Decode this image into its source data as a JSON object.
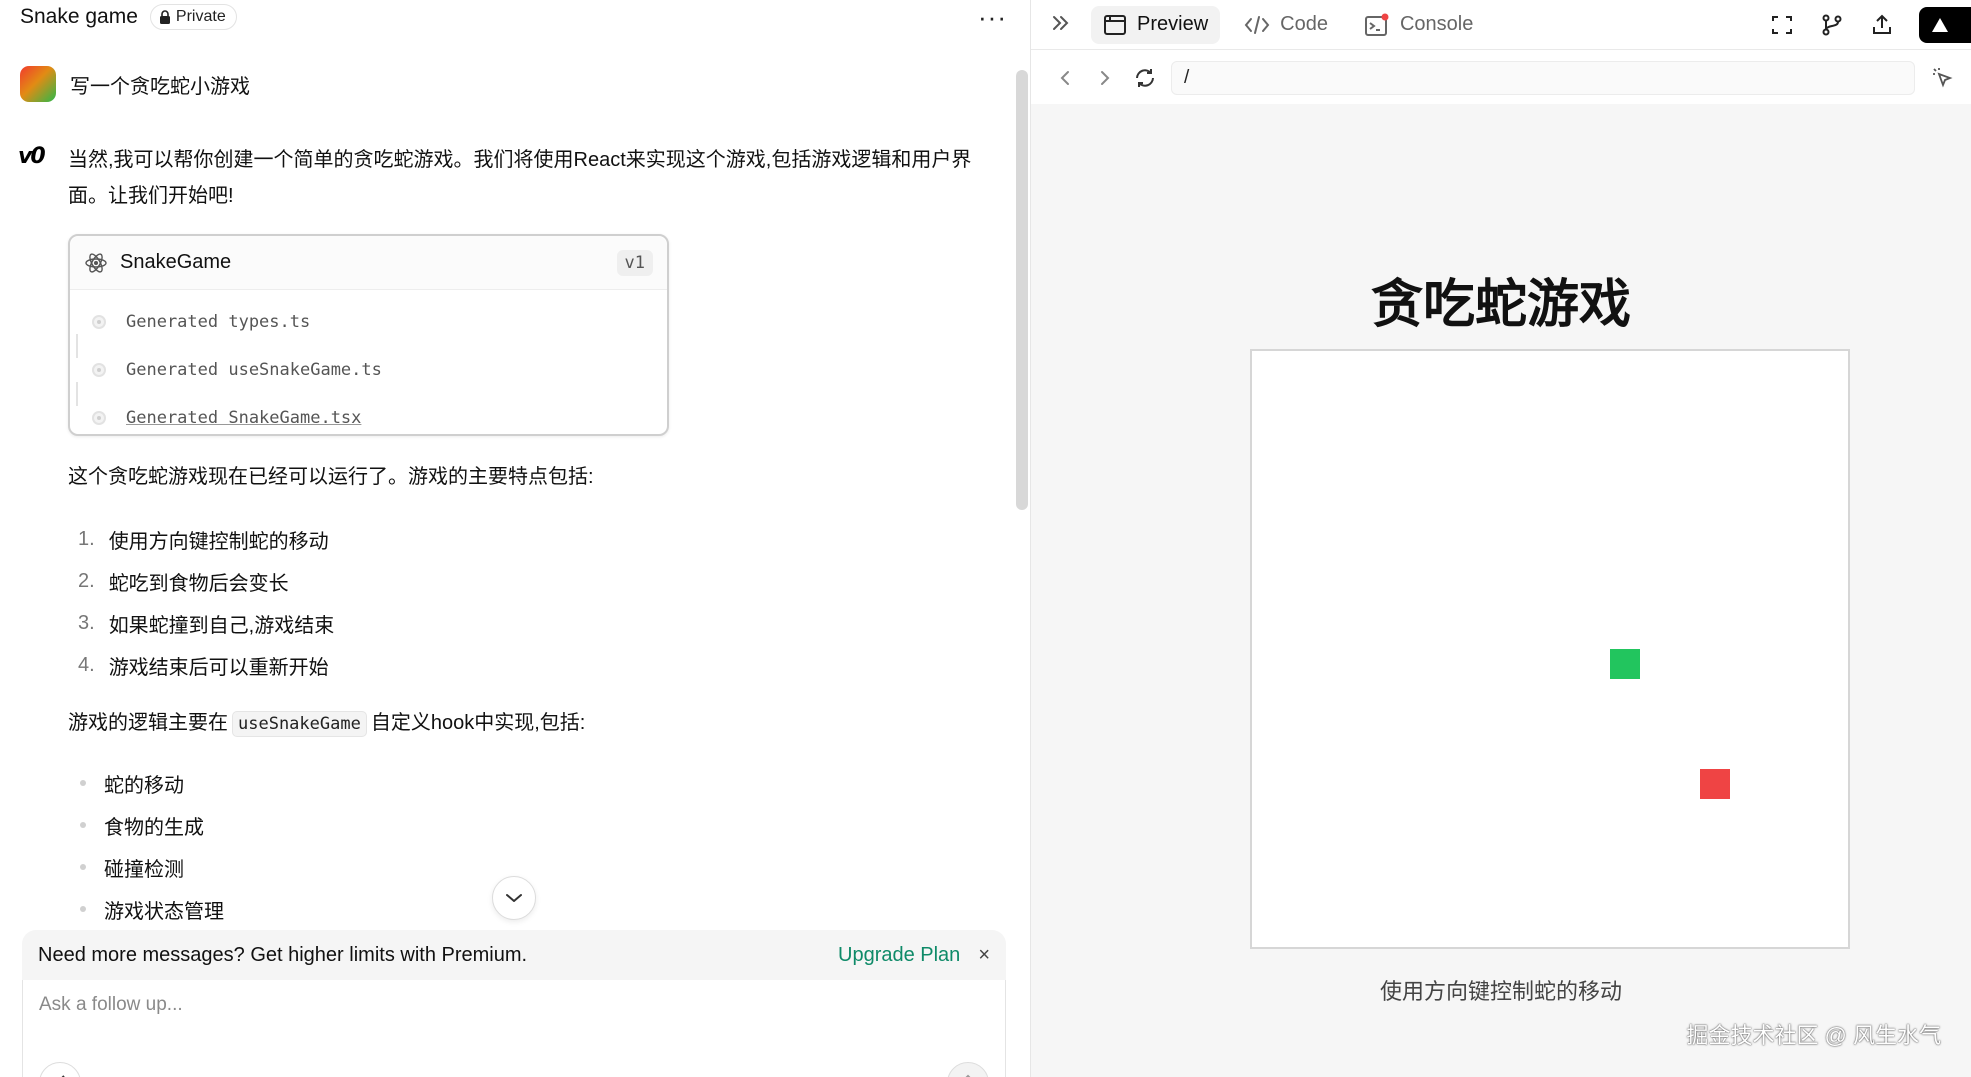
{
  "chat": {
    "title": "Snake game",
    "privacy_label": "Private",
    "more_label": "···"
  },
  "user_message": {
    "text": "写一个贪吃蛇小游戏"
  },
  "assistant": {
    "logo": "v0",
    "intro": "当然,我可以帮你创建一个简单的贪吃蛇游戏。我们将使用React来实现这个游戏,包括游戏逻辑和用户界面。让我们开始吧!",
    "artifact": {
      "name": "SnakeGame",
      "version": "v1",
      "steps": [
        "Generated types.ts",
        "Generated useSnakeGame.ts",
        "Generated SnakeGame.tsx"
      ]
    },
    "features_intro": "这个贪吃蛇游戏现在已经可以运行了。游戏的主要特点包括:",
    "features": [
      {
        "num": "1.",
        "text": "使用方向键控制蛇的移动"
      },
      {
        "num": "2.",
        "text": "蛇吃到食物后会变长"
      },
      {
        "num": "3.",
        "text": "如果蛇撞到自己,游戏结束"
      },
      {
        "num": "4.",
        "text": "游戏结束后可以重新开始"
      }
    ],
    "logic_prefix": "游戏的逻辑主要在",
    "logic_code": "useSnakeGame",
    "logic_suffix": "自定义hook中实现,包括:",
    "logic_items": [
      "蛇的移动",
      "食物的生成",
      "碰撞检测",
      "游戏状态管理"
    ]
  },
  "banner": {
    "text": "Need more messages? Get higher limits with Premium.",
    "upgrade_label": "Upgrade Plan",
    "close_label": "×"
  },
  "composer": {
    "placeholder": "Ask a follow up..."
  },
  "right_tabs": {
    "collapse_label": "»",
    "preview_label": "Preview",
    "code_label": "Code",
    "console_label": "Console"
  },
  "url_bar": {
    "path": "/"
  },
  "preview": {
    "game_title": "贪吃蛇游戏",
    "hint": "使用方向键控制蛇的移动",
    "grid_cells": 20,
    "snake_segments": [
      [
        12,
        10
      ]
    ],
    "food": [
      15,
      14
    ],
    "snake_color": "#22c55e",
    "food_color": "#ef4444"
  },
  "watermark": "掘金技术社区 @ 风生水气"
}
